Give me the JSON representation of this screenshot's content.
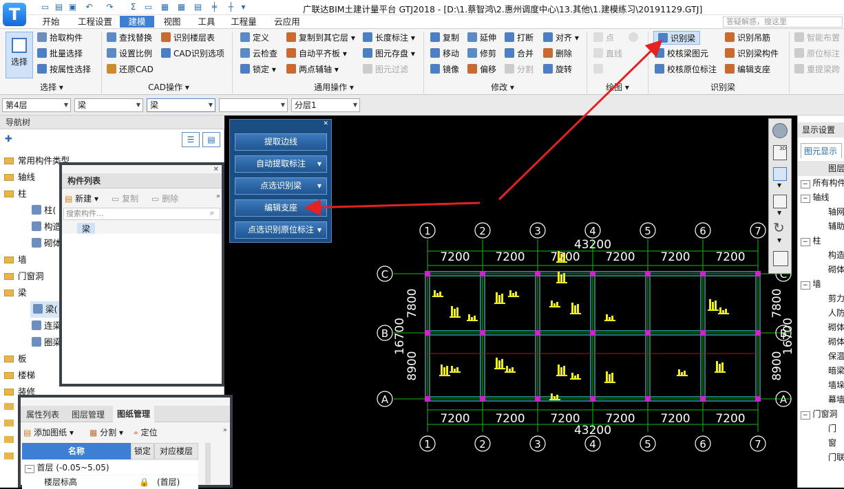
{
  "title_bar": {
    "title": "广联达BIM土建计量平台 GTJ2018 - [D:\\1.蔡智鸿\\2.惠州调度中心\\13.其他\\1.建模练习\\20191129.GTJ]",
    "logo": "T",
    "search_placeholder": "答疑解惑，搜这里"
  },
  "menu": [
    "开始",
    "工程设置",
    "建模",
    "视图",
    "工具",
    "工程量",
    "云应用"
  ],
  "ribbon": {
    "select": {
      "label": "选择",
      "group": "选择"
    },
    "select_items": [
      "拾取构件",
      "批量选择",
      "按属性选择"
    ],
    "cad_items": [
      "查找替换",
      "识别楼层表",
      "设置比例",
      "CAD识别选项",
      "还原CAD"
    ],
    "cad_group": "CAD操作",
    "general_items": [
      "定义",
      "复制到其它层",
      "长度标注",
      "云检查",
      "自动平齐板",
      "图元存盘",
      "锁定",
      "两点辅轴",
      "图元过滤"
    ],
    "general_group": "通用操作",
    "modify_items": [
      "复制",
      "延伸",
      "打断",
      "对齐",
      "移动",
      "修剪",
      "合并",
      "删除",
      "镜像",
      "偏移",
      "分割",
      "旋转"
    ],
    "modify_group": "修改",
    "draw_items": [
      "点",
      "直线"
    ],
    "draw_group": "绘图",
    "beam_items": [
      "识别梁",
      "识别吊筋",
      "校核梁图元",
      "识别梁构件",
      "校核原位标注",
      "编辑支座"
    ],
    "beam_group": "识别梁",
    "extra_items": [
      "智能布置",
      "原位标注",
      "重提梁跨"
    ]
  },
  "toolbar": {
    "floor": "第4层",
    "type": "梁",
    "subtype": "梁",
    "blank": "",
    "layer": "分层1"
  },
  "nav": {
    "title": "导航树",
    "items": [
      "常用构件类型",
      "轴线",
      "柱",
      "柱(",
      "构造",
      "砌体",
      "墙",
      "门窗洞",
      "梁",
      "梁(",
      "连梁",
      "圈梁",
      "板",
      "楼梯",
      "装修"
    ]
  },
  "component_list": {
    "title": "构件列表",
    "new": "新建",
    "copy": "复制",
    "delete": "删除",
    "search_placeholder": "搜索构件...",
    "item": "梁"
  },
  "drawing_panel": {
    "tabs": [
      "属性列表",
      "图层管理",
      "图纸管理"
    ],
    "add": "添加图纸",
    "split": "分割",
    "locate": "定位",
    "columns": [
      "名称",
      "锁定",
      "对应楼层"
    ],
    "row_group": "首层 (-0.05~5.05)",
    "row": {
      "name": "楼层标高",
      "floor": "(首层)"
    }
  },
  "dialog": {
    "buttons": [
      "提取边线",
      "自动提取标注",
      "点选识别梁",
      "编辑支座",
      "点选识别原位标注"
    ]
  },
  "drawing": {
    "axes_x": [
      "1",
      "2",
      "3",
      "4",
      "5",
      "6",
      "7"
    ],
    "axes_y": [
      "C",
      "B",
      "A"
    ],
    "spans": [
      "7200",
      "7200",
      "7200",
      "7200",
      "7200",
      "7200"
    ],
    "total": "43200",
    "y_spans": [
      "7800",
      "8900"
    ],
    "y_total": "16700"
  },
  "right_panel": {
    "title": "显示设置",
    "tab": "图元显示",
    "header": "图层",
    "items": [
      "所有构件",
      "轴线",
      "轴网",
      "辅助",
      "柱",
      "构造",
      "砌体",
      "墙",
      "剪力",
      "人防",
      "砌体",
      "砌体",
      "保温",
      "暗梁",
      "墙垛",
      "幕墙",
      "门窗洞",
      "门",
      "窗",
      "门联"
    ]
  }
}
